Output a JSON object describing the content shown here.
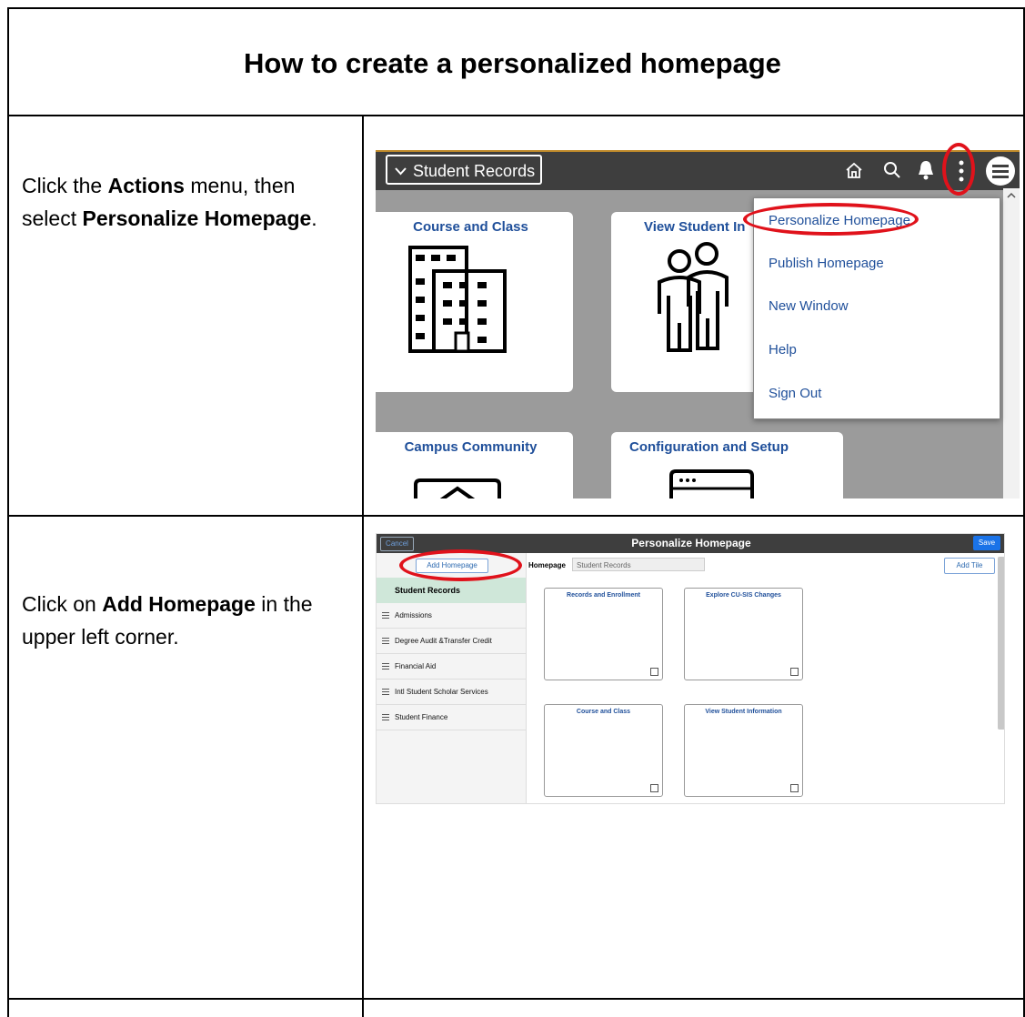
{
  "title": "How to create a personalized homepage",
  "steps": [
    {
      "text_pre": "Click the ",
      "bold1": "Actions",
      "text_mid": " menu, then select ",
      "bold2": "Personalize Homepage",
      "text_post": "."
    },
    {
      "text_pre": "Click on ",
      "bold1": "Add Homepage",
      "text_post": " in the upper left corner."
    }
  ],
  "screenshot1": {
    "homepage_dropdown": "Student Records",
    "tiles": [
      "Course and Class",
      "View Student In",
      "Campus Community",
      "Configuration and Setup"
    ],
    "actions_menu": [
      "Personalize Homepage",
      "Publish Homepage",
      "New Window",
      "Help",
      "Sign Out"
    ],
    "icons": [
      "chevron-down-icon",
      "home-icon",
      "search-icon",
      "bell-icon",
      "kebab-icon",
      "navbar-icon"
    ],
    "highlight_color": "#e0121b"
  },
  "screenshot2": {
    "title": "Personalize Homepage",
    "cancel": "Cancel",
    "save": "Save",
    "add_homepage": "Add Homepage",
    "active_homepage": "Student Records",
    "homepages": [
      "Admissions",
      "Degree Audit &Transfer Credit",
      "Financial Aid",
      "Intl Student Scholar Services",
      "Student Finance"
    ],
    "homepage_label": "Homepage",
    "homepage_value": "Student Records",
    "add_tile": "Add Tile",
    "tiles": [
      "Records and Enrollment",
      "Explore CU-SIS Changes",
      "Course and Class",
      "View Student Information"
    ]
  }
}
